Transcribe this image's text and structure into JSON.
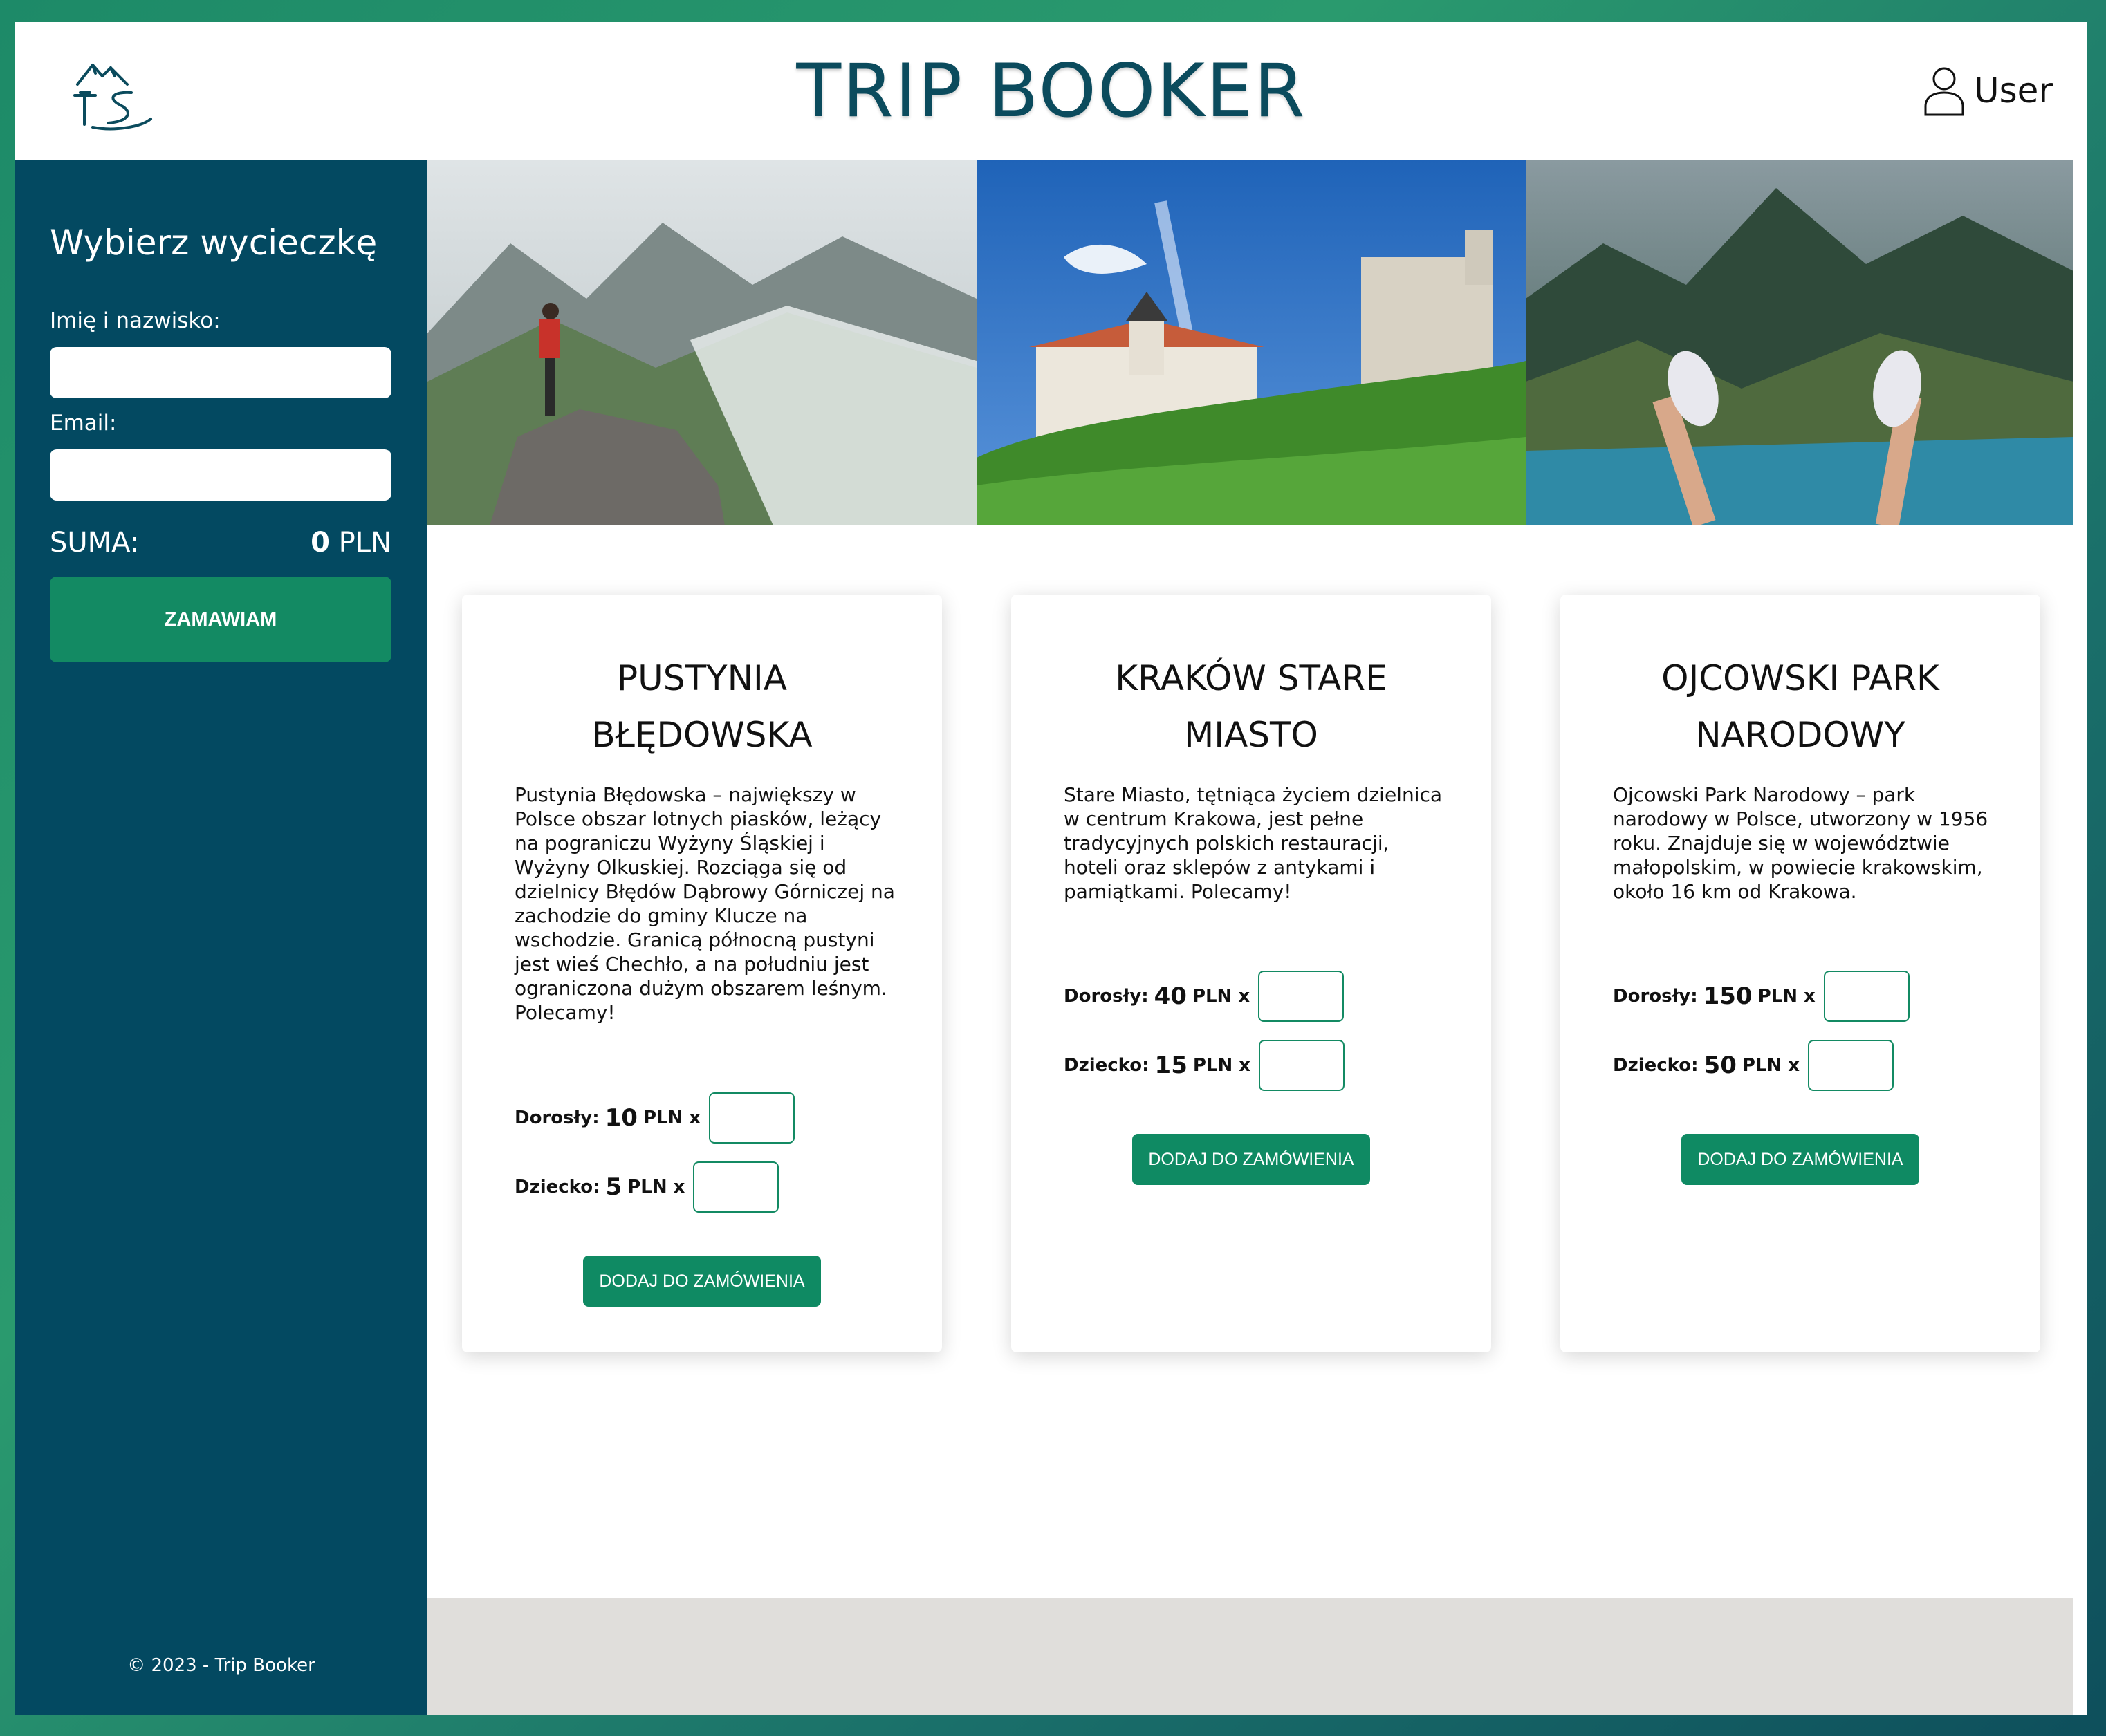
{
  "header": {
    "brand": "TRIP BOOKER",
    "user_label": "User"
  },
  "sidebar": {
    "title": "Wybierz wycieczkę",
    "name_label": "Imię i nazwisko:",
    "email_label": "Email:",
    "name_value": "",
    "email_value": "",
    "sum_label": "SUMA:",
    "sum_value": "0",
    "sum_currency": "PLN",
    "order_button": "ZAMAWIAM",
    "copyright": "© 2023 - Trip Booker"
  },
  "cards": [
    {
      "title_line1": "PUSTYNIA",
      "title_line2": "BŁĘDOWSKA",
      "description": "Pustynia Błędowska – największy w Polsce obszar lotnych piasków, leżący na pograniczu Wyżyny Śląskiej i Wyżyny Olkuskiej. Rozciąga się od dzielnicy Błędów Dąbrowy Górniczej na zachodzie do gminy Klucze na wschodzie. Granicą północną pustyni jest wieś Chechło, a na południu jest ograniczona dużym obszarem leśnym. Polecamy!",
      "adult_label": "Dorosły:",
      "adult_price": "10",
      "child_label": "Dziecko:",
      "child_price": "5",
      "currency_x": "PLN x",
      "button": "DODAJ DO ZAMÓWIENIA"
    },
    {
      "title_line1": "KRAKÓW STARE",
      "title_line2": "MIASTO",
      "description": "Stare Miasto, tętniąca życiem dzielnica w centrum Krakowa, jest pełne tradycyjnych polskich restauracji, hoteli oraz sklepów z antykami i pamiątkami. Polecamy!",
      "adult_label": "Dorosły:",
      "adult_price": "40",
      "child_label": "Dziecko:",
      "child_price": "15",
      "currency_x": "PLN x",
      "button": "DODAJ DO ZAMÓWIENIA"
    },
    {
      "title_line1": "OJCOWSKI PARK",
      "title_line2": "NARODOWY",
      "description": "Ojcowski Park Narodowy – park narodowy w Polsce, utworzony w 1956 roku. Znajduje się w województwie małopolskim, w powiecie krakowskim, około 16 km od Krakowa.",
      "adult_label": "Dorosły:",
      "adult_price": "150",
      "child_label": "Dziecko:",
      "child_price": "50",
      "currency_x": "PLN x",
      "button": "DODAJ DO ZAMÓWIENIA"
    }
  ],
  "colors": {
    "sidebar_bg": "#034961",
    "accent_green": "#138a63",
    "brand_text": "#0b4b5d",
    "footer_bar": "#e0dedb"
  },
  "icons": {
    "logo": "mountain-trail-logo-icon",
    "user": "user-outline-icon"
  }
}
